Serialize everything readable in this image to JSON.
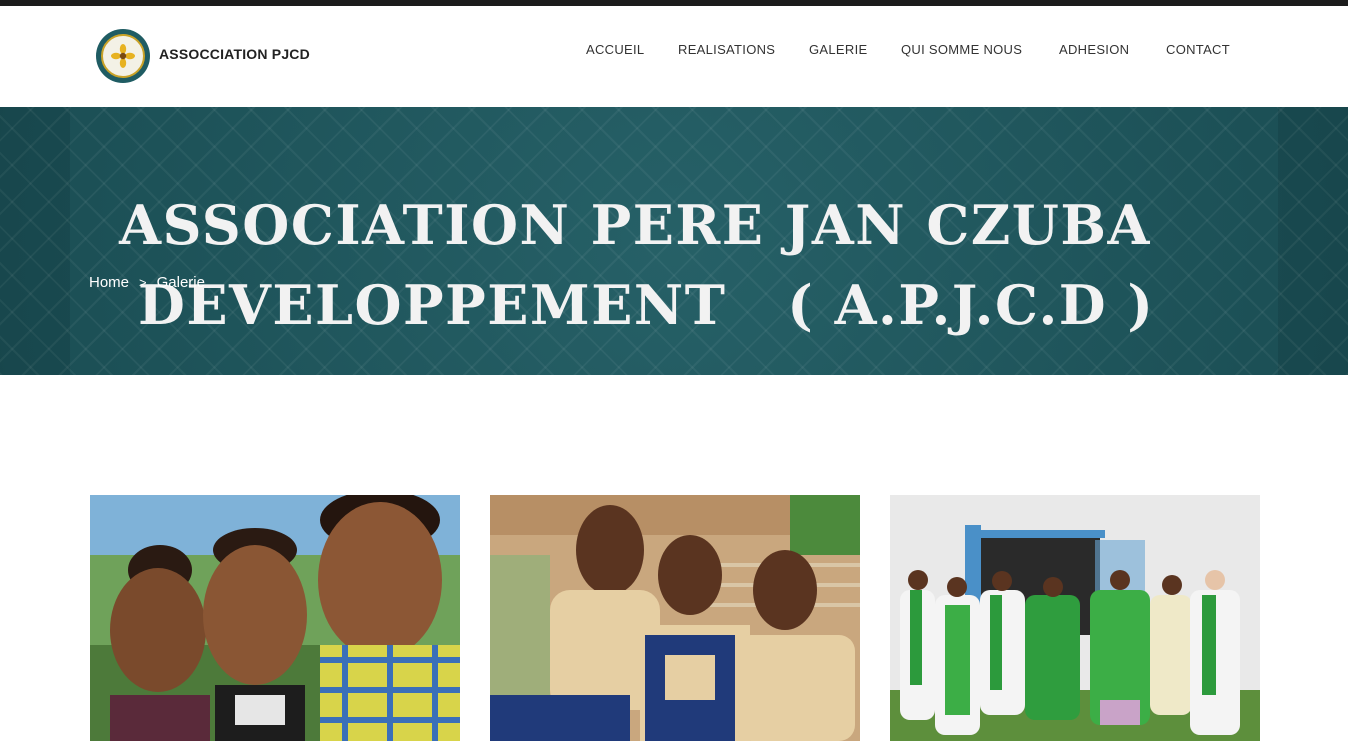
{
  "brand": {
    "name": "ASSOCCIATION PJCD",
    "logo_icon": "association-seal-logo"
  },
  "nav": {
    "items": [
      {
        "label": "ACCUEIL"
      },
      {
        "label": "REALISATIONS"
      },
      {
        "label": "GALERIE"
      },
      {
        "label": "QUI SOMME NOUS"
      },
      {
        "label": "ADHESION"
      },
      {
        "label": "CONTACT"
      }
    ]
  },
  "banner": {
    "line1": "ASSOCIATION PERE JAN CZUBA",
    "line2": "DEVELOPPEMENT   ( A.P.J.C.D )",
    "background_color": "#1f5b62"
  },
  "breadcrumb": {
    "home": "Home",
    "separator": ">",
    "current": "Galerie"
  },
  "gallery": {
    "images": [
      {
        "name": "photo-three-smiling-children"
      },
      {
        "name": "photo-schoolgirls-in-uniform"
      },
      {
        "name": "photo-clergy-procession"
      }
    ]
  },
  "colors": {
    "topbar": "#1c1c1c",
    "text_dark": "#333333",
    "banner_text": "#f2f2f2"
  }
}
